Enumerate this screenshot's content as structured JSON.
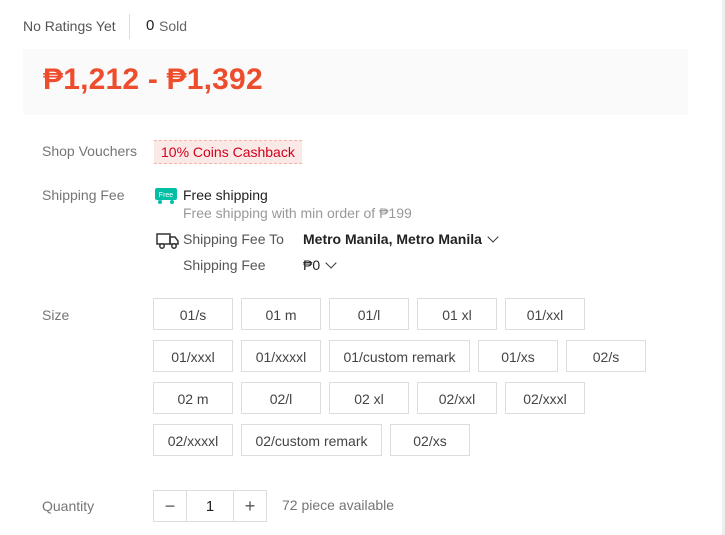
{
  "header": {
    "ratings_text": "No Ratings Yet",
    "sold_count": "0",
    "sold_label": "Sold"
  },
  "price": {
    "range": "₱1,212 - ₱1,392",
    "color": "#ee4d2d"
  },
  "vouchers": {
    "label": "Shop Vouchers",
    "tag": "10% Coins Cashback"
  },
  "shipping": {
    "label": "Shipping Fee",
    "free_icon_text": "Free",
    "free_title": "Free shipping",
    "free_subtitle": "Free shipping with min order of ₱199",
    "to_label": "Shipping Fee To",
    "to_value": "Metro Manila, Metro Manila",
    "fee_label": "Shipping Fee",
    "fee_value": "₱0"
  },
  "size": {
    "label": "Size",
    "options": [
      "01/s",
      "01 m",
      "01/l",
      "01 xl",
      "01/xxl",
      "01/xxxl",
      "01/xxxxl",
      "01/custom remark",
      "01/xs",
      "02/s",
      "02 m",
      "02/l",
      "02 xl",
      "02/xxl",
      "02/xxxl",
      "02/xxxxl",
      "02/custom remark",
      "02/xs"
    ]
  },
  "quantity": {
    "label": "Quantity",
    "minus": "−",
    "value": "1",
    "plus": "+",
    "available": "72 piece available"
  }
}
